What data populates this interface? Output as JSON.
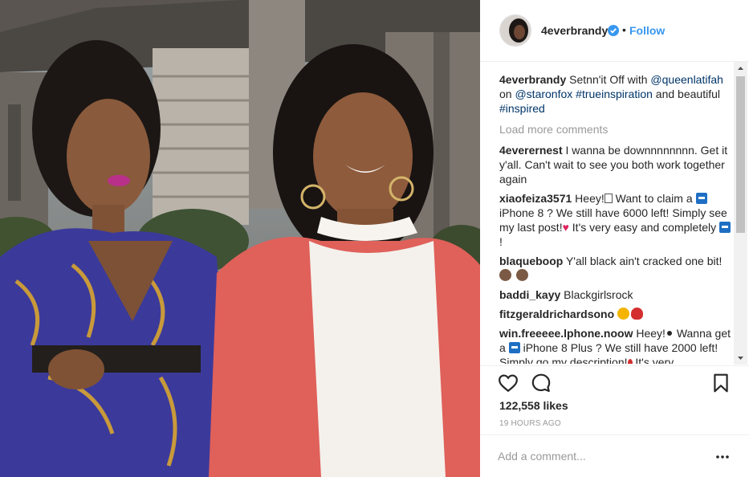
{
  "post": {
    "username": "4everbrandy",
    "follow_label": "Follow",
    "separator": "•",
    "likes": "122,558 likes",
    "time": "19 HOURS AGO"
  },
  "caption": {
    "user": "4everbrandy",
    "text1": " Setnn'it Off with ",
    "mention1": "@queenlatifah",
    "text2": " on ",
    "mention2": "@staronfox",
    "hashtag1": "#trueinspiration",
    "text3": " and beautiful ",
    "hashtag2": "#inspired"
  },
  "load_more": "Load more comments",
  "comments": [
    {
      "user": "4everernest",
      "text": " I wanna be downnnnnnnn. Get it y'all. Can't wait to see you both work together again"
    },
    {
      "user": "xiaofeiza3571",
      "a": " Heey!",
      "b": " Want to claim a ",
      "c": " iPhone 8 ? We still have 6000 left! Simply see my last post!",
      "d": " It's very easy and completely ",
      "e": "!"
    },
    {
      "user": "blaqueboop",
      "text": " Y'all black ain't cracked one bit! "
    },
    {
      "user": "baddi_kayy",
      "text": " Blackgirlsrock"
    },
    {
      "user": "fitzgeraldrichardsono",
      "text": " "
    },
    {
      "user": "win.freeeee.lphone.noow",
      "a": " Heey!",
      "b": " Wanna get a ",
      "c": " iPhone 8 Plus ? We still have 2000 left! Simply go my description!",
      "d": " It's very"
    }
  ],
  "add_comment": {
    "placeholder": "Add a comment..."
  },
  "icons": {
    "like": "heart-outline-icon",
    "comment": "speech-bubble-icon",
    "save": "bookmark-icon",
    "more": "more-options-icon",
    "verified": "verified-badge-icon"
  },
  "colors": {
    "link": "#003569",
    "follow": "#3897f0",
    "verified": "#3897f0"
  }
}
